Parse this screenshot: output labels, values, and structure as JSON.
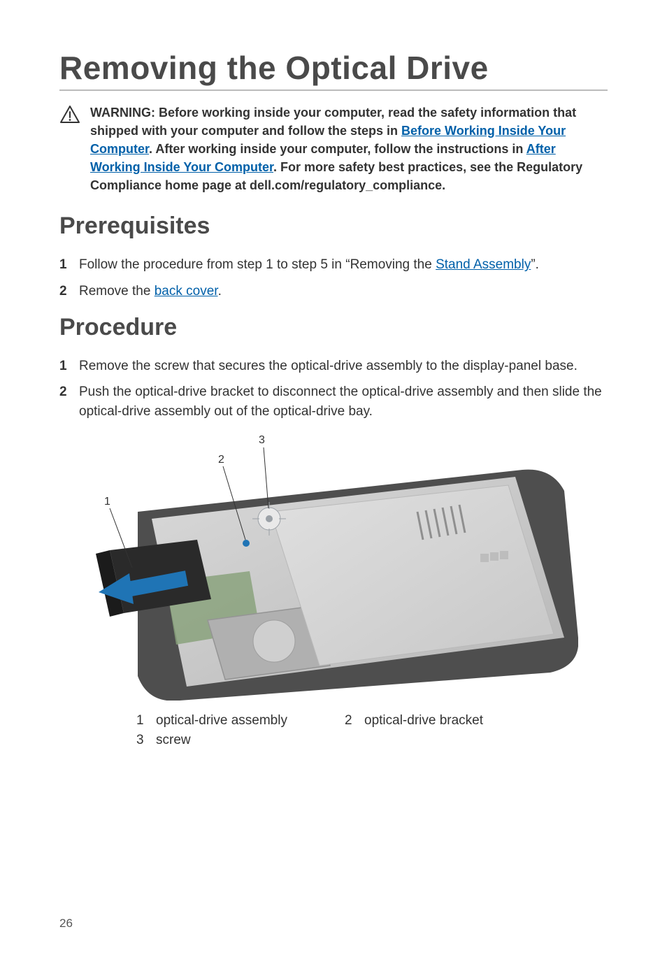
{
  "title": "Removing the Optical Drive",
  "warning": {
    "prefix": "WARNING: Before working inside your computer, read the safety information that shipped with your computer and follow the steps in ",
    "link1": "Before Working Inside Your Computer",
    "mid1": ". After working inside your computer, follow the instructions in ",
    "link2": "After Working Inside Your Computer",
    "suffix": ". For more safety best practices, see the Regulatory Compliance home page at dell.com/regulatory_compliance."
  },
  "sections": {
    "prereq_title": "Prerequisites",
    "proc_title": "Procedure"
  },
  "prereq_steps": [
    {
      "num": "1",
      "before": "Follow the procedure from step 1 to step 5 in “Removing the ",
      "link": "Stand Assembly",
      "after": "”."
    },
    {
      "num": "2",
      "before": "Remove the ",
      "link": "back cover",
      "after": "."
    }
  ],
  "proc_steps": [
    {
      "num": "1",
      "text": "Remove the screw that secures the optical-drive assembly to the display-panel base."
    },
    {
      "num": "2",
      "text": "Push the optical-drive bracket to disconnect the optical-drive assembly and then slide the optical-drive assembly out of the optical-drive bay."
    }
  ],
  "figure_labels": {
    "l1": "1",
    "l2": "2",
    "l3": "3"
  },
  "callouts": [
    {
      "num": "1",
      "text": "optical-drive assembly"
    },
    {
      "num": "2",
      "text": "optical-drive bracket"
    },
    {
      "num": "3",
      "text": "screw"
    }
  ],
  "page_number": "26"
}
